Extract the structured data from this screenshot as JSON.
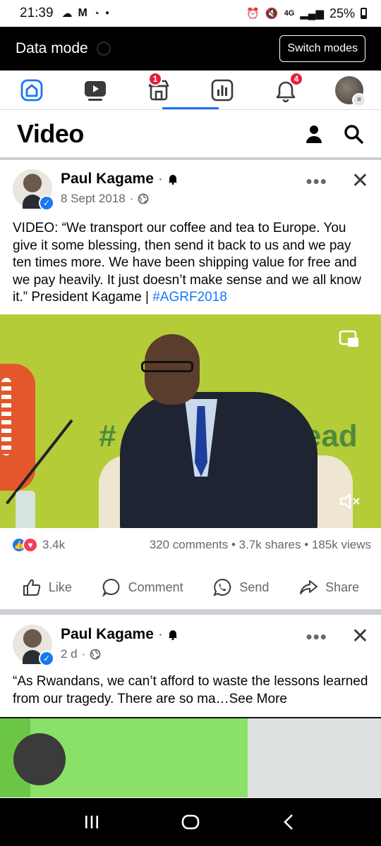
{
  "status_bar": {
    "time": "21:39",
    "network": "4G",
    "battery": "25%"
  },
  "data_mode": {
    "title": "Data mode",
    "switch_label": "Switch modes"
  },
  "nav": {
    "items": [
      {
        "icon": "home-icon",
        "badge": ""
      },
      {
        "icon": "video-icon",
        "badge": ""
      },
      {
        "icon": "marketplace-icon",
        "badge": "1"
      },
      {
        "icon": "feeds-icon",
        "badge": ""
      },
      {
        "icon": "notifications-icon",
        "badge": "4"
      },
      {
        "icon": "profile-menu-icon",
        "badge": ""
      }
    ],
    "active_index": 3,
    "accent": "#1877f2"
  },
  "header": {
    "title": "Video"
  },
  "post1": {
    "author": "Paul Kagame",
    "date": "8 Sept 2018",
    "text": "VIDEO: “We transport our coffee and tea to Europe. You give it some blessing, then send it back to us and we pay ten times more. We have been shipping value for free and we pay heavily. It just doesn’t make sense and we all know it.” President Kagame | ",
    "hashtag": "#AGRF2018",
    "video_bg_hash": "#",
    "video_bg_word": "Lead",
    "reaction_count": "3.4k",
    "stats": "320 comments • 3.7k shares • 185k views",
    "actions": {
      "like": "Like",
      "comment": "Comment",
      "send": "Send",
      "share": "Share"
    }
  },
  "post2": {
    "author": "Paul Kagame",
    "date": "2 d",
    "text": "“As Rwandans, we can’t afford to waste the lessons learned from our tragedy. There are so ma…",
    "see_more": "See More"
  },
  "colors": {
    "brand": "#1877f2",
    "badge": "#e41e3f",
    "video_green": "#b4cc37"
  }
}
